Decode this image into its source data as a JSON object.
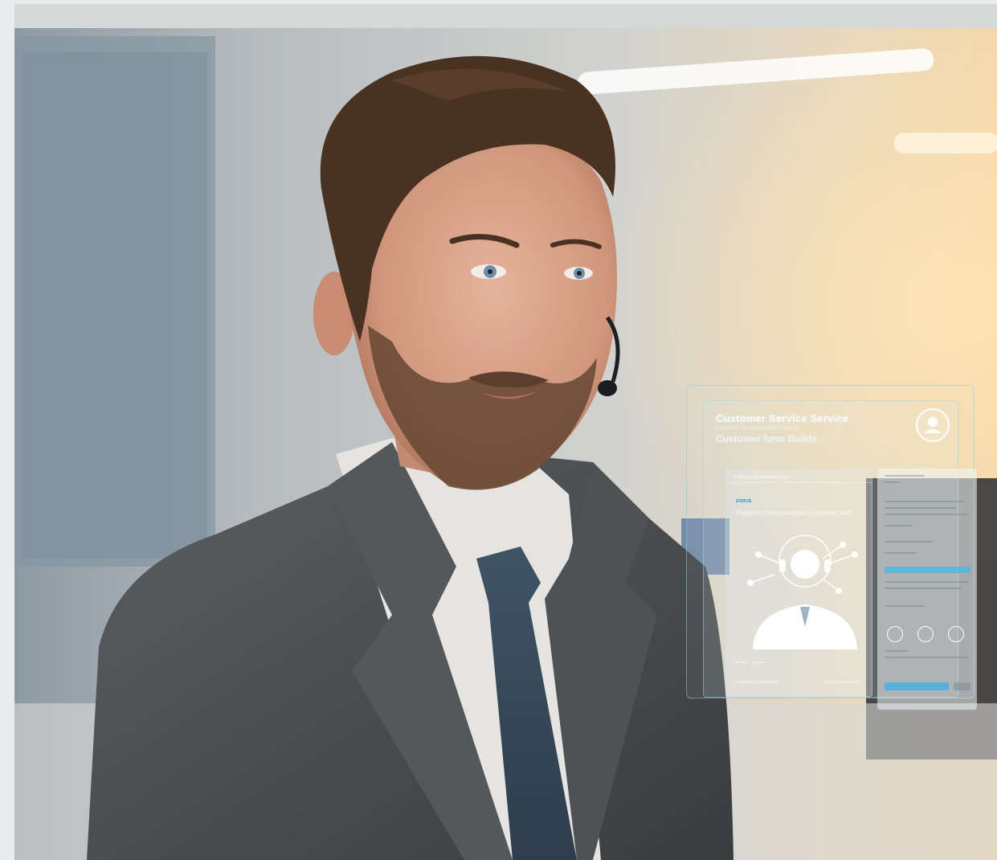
{
  "hud": {
    "title": "Customer Service Service",
    "subtitle": "Customer's list conversations Chat info",
    "title2": "Customer form Builds",
    "card_header": "Customer conversation history",
    "chip": "STATUS",
    "headline": "Platform conversation customerized",
    "footer_left": "Customer conversation",
    "footer_right": "Support conversation"
  },
  "colors": {
    "accent": "#2b95cf",
    "hud_border": "#8cc8e1",
    "suit": "#505356"
  },
  "icons": [
    "user-avatar-icon",
    "headset-agent-icon",
    "cloud-icon",
    "refresh-icon",
    "cycle-icon"
  ]
}
